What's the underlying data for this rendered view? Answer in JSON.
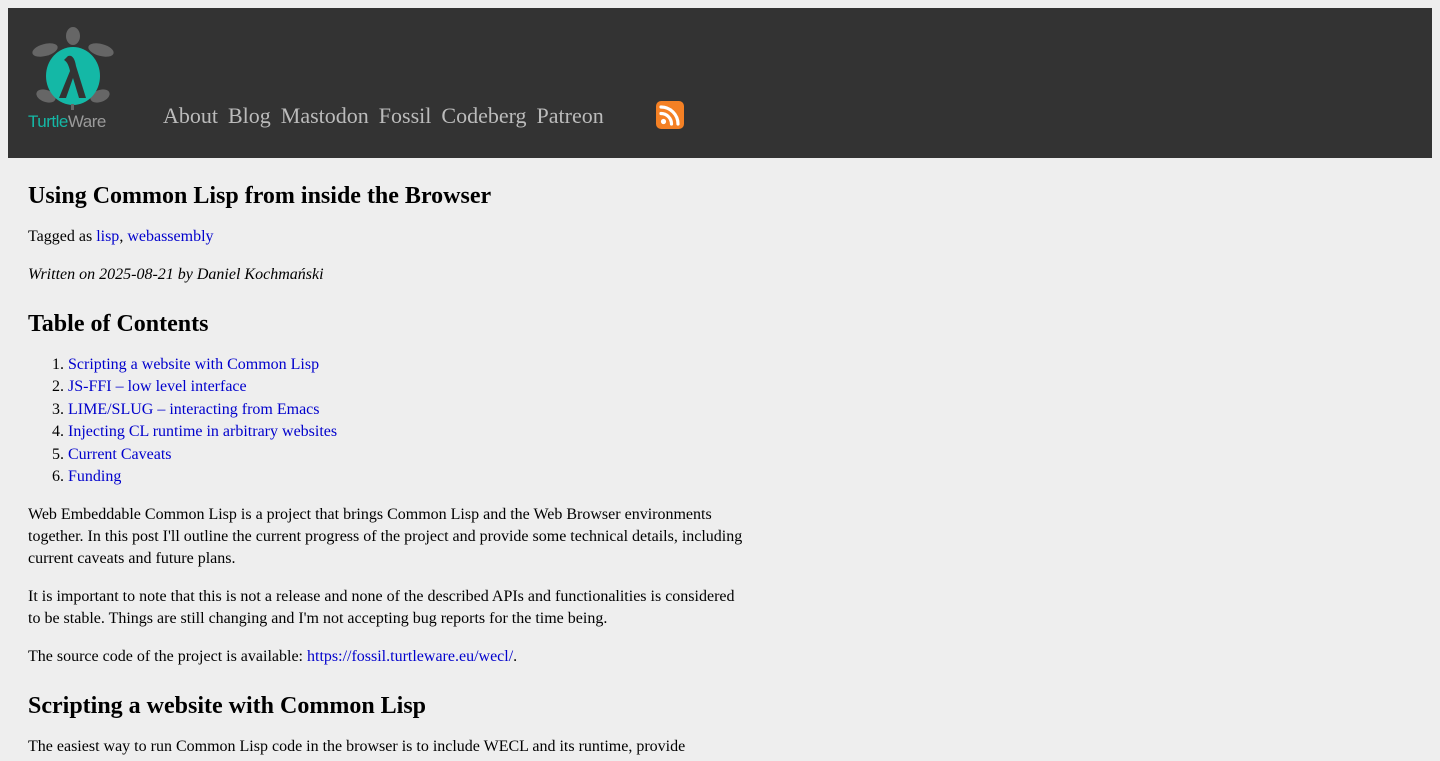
{
  "header": {
    "logo_text_part1": "Turtle",
    "logo_text_part2": "Ware",
    "nav": [
      {
        "label": "About"
      },
      {
        "label": "Blog"
      },
      {
        "label": "Mastodon"
      },
      {
        "label": "Fossil"
      },
      {
        "label": "Codeberg"
      },
      {
        "label": "Patreon"
      }
    ],
    "rss_icon": "rss-feed-icon"
  },
  "article": {
    "title": "Using Common Lisp from inside the Browser",
    "tagged_prefix": "Tagged as ",
    "tags": [
      "lisp",
      "webassembly"
    ],
    "tag_separator": ", ",
    "written": "Written on 2025-08-21 by Daniel Kochmański",
    "toc_heading": "Table of Contents",
    "toc": [
      "Scripting a website with Common Lisp",
      "JS-FFI – low level interface",
      "LIME/SLUG – interacting from Emacs",
      "Injecting CL runtime in arbitrary websites",
      "Current Caveats",
      "Funding"
    ],
    "para1": "Web Embeddable Common Lisp is a project that brings Common Lisp and the Web Browser environments together. In this post I'll outline the current progress of the project and provide some technical details, including current caveats and future plans.",
    "para2": "It is important to note that this is not a release and none of the described APIs and functionalities is considered to be stable. Things are still changing and I'm not accepting bug reports for the time being.",
    "para3_prefix": "The source code of the project is available: ",
    "para3_link": "https://fossil.turtleware.eu/wecl/",
    "para3_suffix": ".",
    "section1_heading": "Scripting a website with Common Lisp",
    "para4_partial": "The easiest way to run Common Lisp code in the browser is to include WECL and its runtime, provide"
  },
  "colors": {
    "header_bg": "#333333",
    "page_bg": "#eeeeee",
    "link": "#0000cc",
    "nav_link": "#bbbbbb",
    "logo_teal": "#14b8a6",
    "rss_orange": "#f48024"
  }
}
